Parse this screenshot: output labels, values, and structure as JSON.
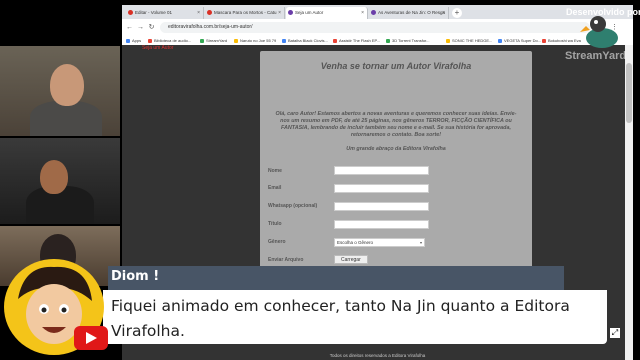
{
  "browser": {
    "tabs": [
      {
        "label": "Editar - Volume 01"
      },
      {
        "label": "Mascara Para os Mortos - Catu"
      },
      {
        "label": "Seja um Autor"
      },
      {
        "label": "As Aventuras de Na Jin: O Resga"
      }
    ],
    "url": "editoravirafolha.com.br/seja-um-autor/",
    "bookmarks": [
      {
        "label": "Apps",
        "color": "#4285f4"
      },
      {
        "label": "Biblioteca de audio...",
        "color": "#ea4335"
      },
      {
        "label": "StreamYard",
        "color": "#34a853"
      },
      {
        "label": "Naruto no Joe 55 79",
        "color": "#fbbc05"
      },
      {
        "label": "Batalha Black Clovis...",
        "color": "#4285f4"
      },
      {
        "label": "Assistir The Flash EP...",
        "color": "#ea4335"
      },
      {
        "label": "3D Torrent Transfor...",
        "color": "#34a853"
      },
      {
        "label": "SONIC THE HEDGE...",
        "color": "#fbbc05"
      },
      {
        "label": "VEGETA Super Do...",
        "color": "#4285f4"
      },
      {
        "label": "Bokuboshi wa Eva",
        "color": "#ea4335"
      }
    ]
  },
  "page": {
    "top_link": "Seja um Autor",
    "title": "Venha se tornar um Autor Virafolha",
    "intro": "Olá, caro Autor! Estamos abertos a novas aventuras e queremos conhecer suas ideias. Envie-nos um resumo em PDF, de até 25 páginas, nos gêneros TERROR, FICÇÃO CIENTÍFICA ou FANTASIA, lembrando de incluir também seu nome e e-mail. Se sua história for aprovada, retornaremos o contato. Boa sorte!",
    "signoff": "Um grande abraço da Editora Virafolha",
    "fields": {
      "name": "Nome",
      "email": "Email",
      "whatsapp": "Whatsapp (opcional)",
      "title": "Título",
      "genre": "Gênero",
      "file": "Enviar Arquivo"
    },
    "genre_selected": "Escolha o Gênero",
    "upload_button": "Carregar",
    "footer": "Todos os direitos reservados a Editora Virafolha"
  },
  "overlay": {
    "title": "Desenvolvido por",
    "brand": "StreamYard"
  },
  "lower_third": {
    "name": "Diom !",
    "caption": "Fiquei animado em conhecer, tanto Na Jin quanto a Editora Virafolha."
  },
  "colors": {
    "name_bar": "#485566",
    "youtube": "#e01818",
    "avatar_bg": "#f4c419"
  }
}
